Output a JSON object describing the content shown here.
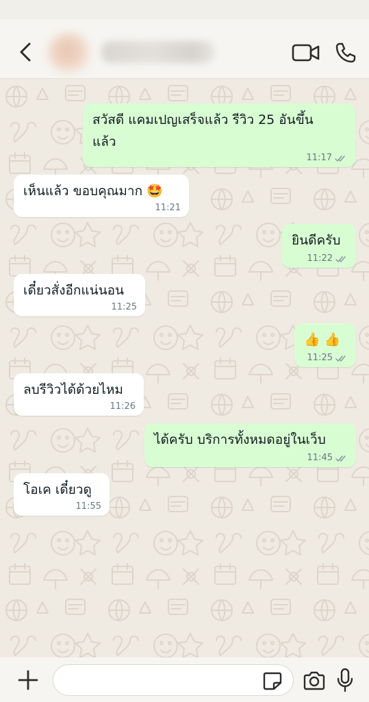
{
  "header": {
    "contact_name": "",
    "back_icon": "chevron-left-icon",
    "video_icon": "video-camera-icon",
    "call_icon": "phone-icon"
  },
  "messages": [
    {
      "dir": "out",
      "lines": [
        "สวัสดี แคมเปญเสร็จแล้ว รีวิว 25 อันขึ้น",
        "แล้ว"
      ],
      "time": "11:17",
      "read": true
    },
    {
      "dir": "in",
      "lines": [
        "เห็นแล้ว ขอบคุณมาก 🤩"
      ],
      "time": "11:21"
    },
    {
      "dir": "out",
      "lines": [
        "ยินดีครับ"
      ],
      "time": "11:22",
      "read": true
    },
    {
      "dir": "in",
      "lines": [
        "เดี๋ยวสั่งอีกแน่นอน"
      ],
      "time": "11:25"
    },
    {
      "dir": "out",
      "lines": [
        "👍 👍"
      ],
      "time": "11:25",
      "read": true
    },
    {
      "dir": "in",
      "lines": [
        "ลบรีวิวได้ด้วยไหม"
      ],
      "time": "11:26"
    },
    {
      "dir": "out",
      "lines": [
        "ได้ครับ บริการทั้งหมดอยู่ในเว็บ"
      ],
      "time": "11:45",
      "read": true
    },
    {
      "dir": "in",
      "lines": [
        "โอเค เดี๋ยวดู"
      ],
      "time": "11:55"
    }
  ],
  "composer": {
    "placeholder": "",
    "icons": [
      "plus-icon",
      "sticker-icon",
      "camera-icon",
      "microphone-icon"
    ]
  },
  "colors": {
    "outgoing_bubble": "#d9fdd3",
    "incoming_bubble": "#ffffff",
    "chat_background": "#efeae2",
    "tick": "#8696a0"
  }
}
